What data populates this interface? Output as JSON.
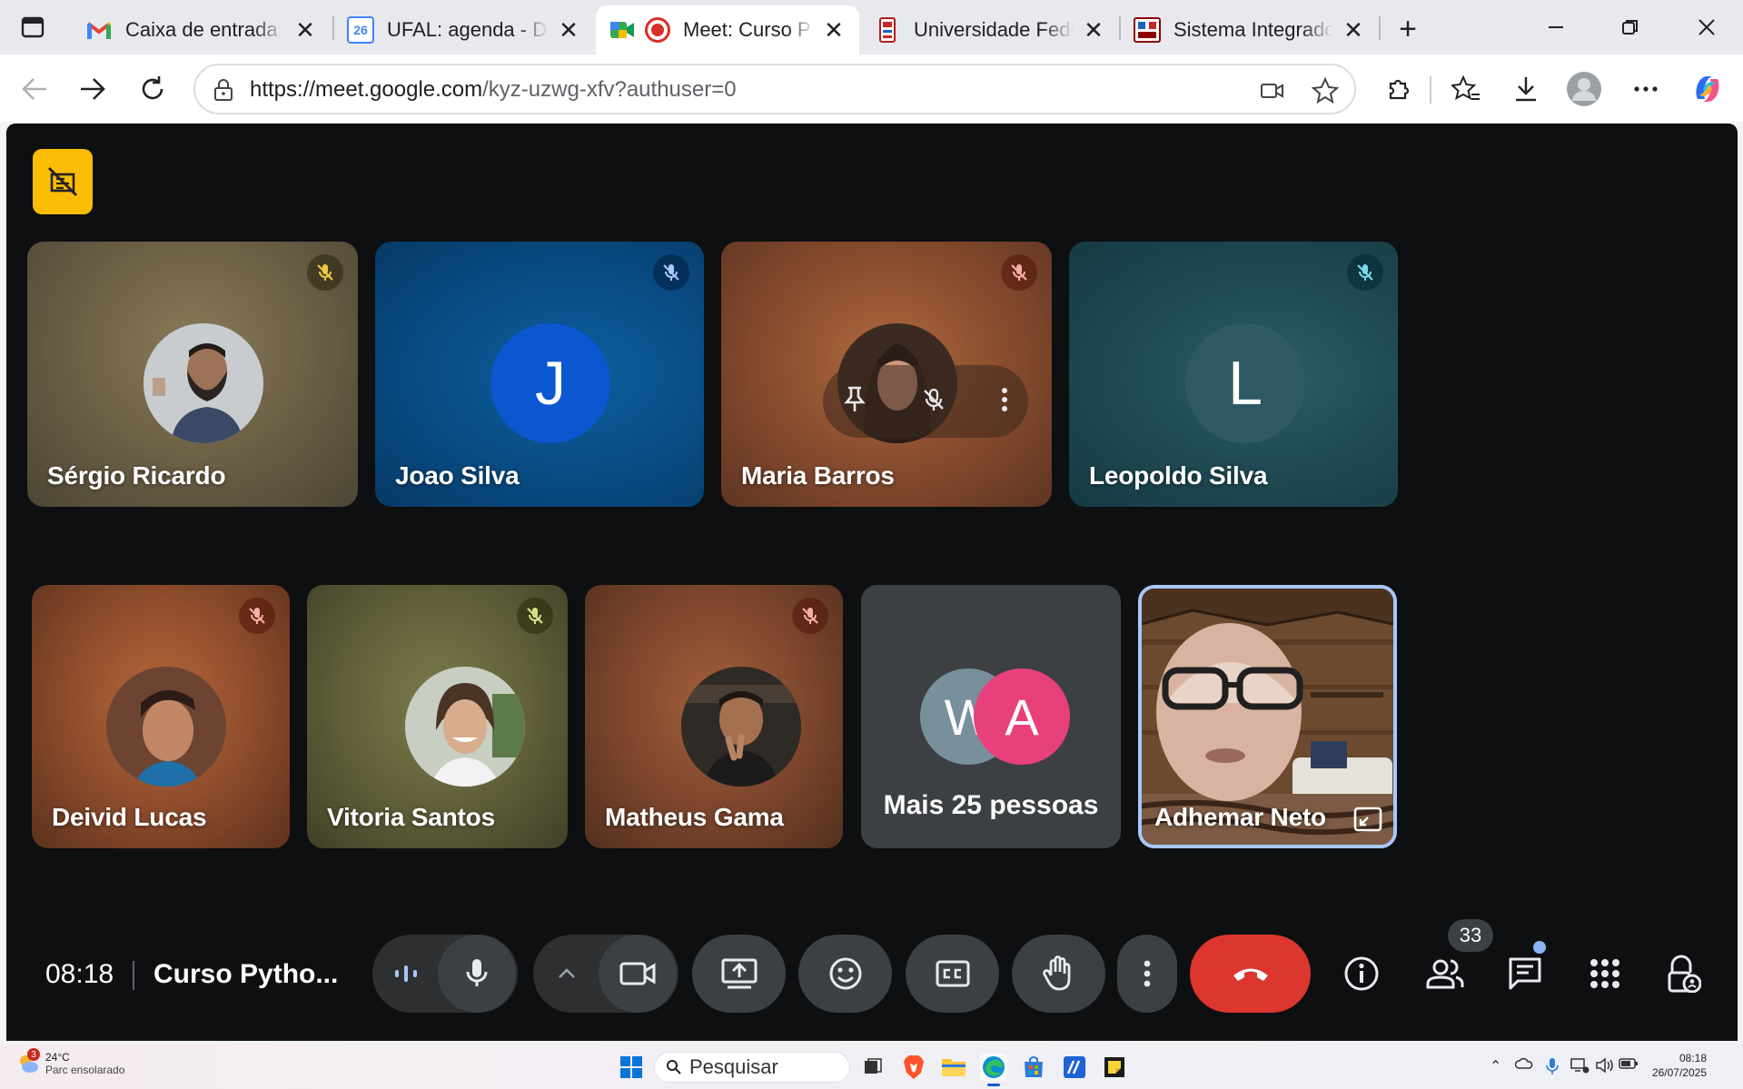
{
  "browser": {
    "tabs": [
      {
        "title": "Caixa de entrada (",
        "favicon": "gmail-icon",
        "active": false
      },
      {
        "title": "UFAL: agenda - De",
        "favicon": "calendar-icon",
        "favicon_text": "26",
        "active": false
      },
      {
        "title": "Meet: Curso P",
        "favicon": "meet-icon",
        "recording": true,
        "active": true
      },
      {
        "title": "Universidade Fede",
        "favicon": "ufal-icon",
        "active": false
      },
      {
        "title": "Sistema Integrado",
        "favicon": "sig-icon",
        "active": false
      }
    ],
    "url_host": "https://meet.google.com",
    "url_path": "/kyz-uzwg-xfv?authuser=0"
  },
  "meet": {
    "participants_row1": [
      {
        "name": "Sérgio Ricardo",
        "avatar": "photo",
        "muted": true
      },
      {
        "name": "Joao Silva",
        "avatar_letter": "J",
        "muted": true
      },
      {
        "name": "Maria Barros",
        "avatar": "photo",
        "muted": true
      },
      {
        "name": "Leopoldo Silva",
        "avatar_letter": "L",
        "muted": true
      }
    ],
    "participants_row2": [
      {
        "name": "Deivid Lucas",
        "avatar": "photo",
        "muted": true
      },
      {
        "name": "Vitoria Santos",
        "avatar": "photo",
        "muted": true
      },
      {
        "name": "Matheus Gama",
        "avatar": "photo",
        "muted": true
      }
    ],
    "more_tile": {
      "letters": [
        "W",
        "A"
      ],
      "label": "Mais 25 pessoas"
    },
    "self_tile": {
      "name": "Adhemar Neto"
    },
    "clock": "08:18",
    "meeting_title": "Curso Pytho...",
    "participant_count": "33"
  },
  "taskbar": {
    "weather_badge": "3",
    "temperature": "24°C",
    "weather_text": "Parc ensolarado",
    "search_placeholder": "Pesquisar",
    "time": "08:18",
    "date": "26/07/2025"
  },
  "colors": {
    "meet_bg": "#0e0f11",
    "tile_grey": "#3c4043",
    "hangup_red": "#dc362e",
    "badge_yellow": "#fbbc04",
    "self_border": "#a8c7fa",
    "avatar_blue": "#0b57d0",
    "avatar_pink": "#e8407b"
  }
}
